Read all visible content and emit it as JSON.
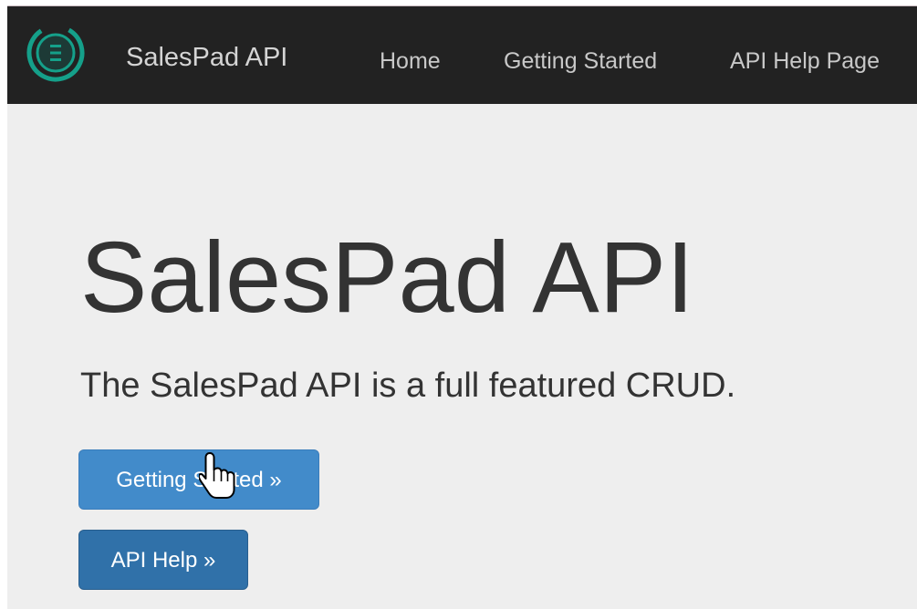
{
  "navbar": {
    "brand": "SalesPad API",
    "links": [
      {
        "label": "Home"
      },
      {
        "label": "Getting Started"
      },
      {
        "label": "API Help Page"
      }
    ]
  },
  "hero": {
    "title": "SalesPad API",
    "lead": "The SalesPad API is a full featured CRUD.",
    "buttons": [
      {
        "label": "Getting Started »"
      },
      {
        "label": "API Help »"
      }
    ]
  },
  "icons": {
    "logo": "salespad-logo-icon",
    "cursor": "hand-pointer-cursor-icon"
  },
  "colors": {
    "navbar_bg": "#222222",
    "jumbotron_bg": "#eeeeee",
    "button_primary": "#428bca",
    "button_active": "#3071a9",
    "logo_accent": "#15a08a"
  }
}
